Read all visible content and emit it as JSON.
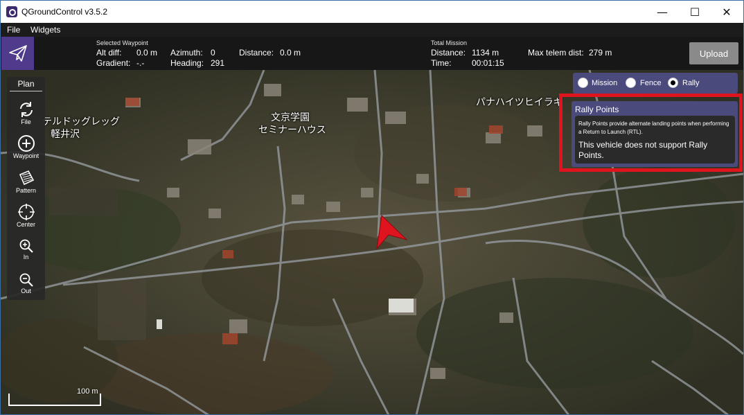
{
  "window": {
    "title": "QGroundControl v3.5.2",
    "minimize": "—",
    "maximize": "☐",
    "close": "✕"
  },
  "menu": {
    "file": "File",
    "widgets": "Widgets"
  },
  "toolbar": {
    "selected_waypoint_label": "Selected Waypoint",
    "alt_diff_label": "Alt diff:",
    "alt_diff_value": "0.0 m",
    "gradient_label": "Gradient:",
    "gradient_value": "-.-",
    "azimuth_label": "Azimuth:",
    "azimuth_value": "0",
    "heading_label": "Heading:",
    "heading_value": "291",
    "distance_label": "Distance:",
    "distance_value": "0.0 m",
    "total_mission_label": "Total Mission",
    "total_distance_label": "Distance:",
    "total_distance_value": "1134 m",
    "time_label": "Time:",
    "time_value": "00:01:15",
    "max_telem_label": "Max telem dist:",
    "max_telem_value": "279 m",
    "upload_label": "Upload"
  },
  "plan_panel": {
    "title": "Plan",
    "tools": [
      {
        "label": "File",
        "icon": "sync-icon"
      },
      {
        "label": "Waypoint",
        "icon": "plus-circle-icon"
      },
      {
        "label": "Pattern",
        "icon": "pattern-icon"
      },
      {
        "label": "Center",
        "icon": "crosshair-icon"
      },
      {
        "label": "In",
        "icon": "zoom-in-icon"
      },
      {
        "label": "Out",
        "icon": "zoom-out-icon"
      }
    ]
  },
  "mode": {
    "mission": "Mission",
    "fence": "Fence",
    "rally": "Rally",
    "selected": "Rally"
  },
  "rally": {
    "title": "Rally Points",
    "description": "Rally Points provide alternate landing points when performing a Return to Launch (RTL).",
    "warning": "This vehicle does not support Rally Points."
  },
  "map": {
    "labels": [
      "テルドッグレッグ",
      "軽井沢",
      "文京学園",
      "セミナーハウス",
      "パナハイツヒイラギ"
    ],
    "scale_label": "100 m"
  },
  "colors": {
    "accent": "#4f3a8c",
    "panel": "#4a4a7d",
    "highlight": "#e0141e",
    "vehicle": "#e0141e"
  }
}
